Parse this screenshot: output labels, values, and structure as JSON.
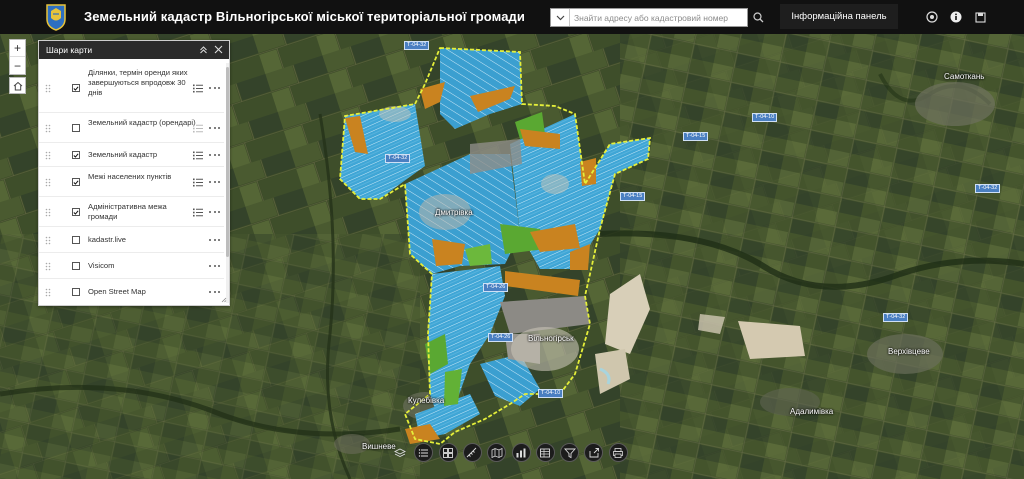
{
  "app": {
    "title": "Земельний кадастр Вільногірської міської територіальної громади",
    "search_placeholder": "Знайти адресу або кадастровий номер",
    "info_panel_label": "Інформаційна панель"
  },
  "layers_panel": {
    "title": "Шари карти",
    "layers": [
      {
        "label": "Ділянки, термін оренди яких завершуються впродовж 30 днів",
        "checked": true,
        "has_legend": true
      },
      {
        "label": "Земельний кадастр (орендарі)",
        "checked": false,
        "has_legend": true
      },
      {
        "label": "Земельний кадастр",
        "checked": true,
        "has_legend": true
      },
      {
        "label": "Межі населених пунктів",
        "checked": true,
        "has_legend": true
      },
      {
        "label": "Адміністративна межа громади",
        "checked": true,
        "has_legend": true
      },
      {
        "label": "kadastr.live",
        "checked": false,
        "has_legend": false
      },
      {
        "label": "Visicom",
        "checked": false,
        "has_legend": false
      },
      {
        "label": "Open Street Map",
        "checked": false,
        "has_legend": false
      }
    ]
  },
  "map": {
    "places": {
      "dmytrivka": "Дмитрівка",
      "vilnohirsk": "Вільногірськ",
      "kulebivka": "Кулебівка",
      "vyshneve": "Вишневе",
      "adalymivka": "Адалимівка",
      "verkhivtseve": "Верхівцеве",
      "samotkan": "Самоткань"
    },
    "roads": {
      "r1": "Т-04-32",
      "r2": "Т-04-32",
      "r3": "Т-04-15",
      "r4": "Т-04-10",
      "r5": "Т-04-15",
      "r6": "Т-04-32",
      "r7": "Т-04-26",
      "r8": "Т-04-32",
      "r9": "Т-04-10",
      "r10": "Т-04-26"
    }
  },
  "icons": {
    "zoom_in": "plus-icon",
    "zoom_out": "minus-icon",
    "home": "home-icon",
    "search": "search-icon",
    "share": "eye-icon",
    "info": "info-icon",
    "save": "save-icon",
    "tools": [
      "layers-icon",
      "list-icon",
      "grid-icon",
      "measure-icon",
      "basemap-icon",
      "chart-icon",
      "table-icon",
      "filter-icon",
      "export-icon",
      "print-icon"
    ]
  },
  "colors": {
    "header": "#111111",
    "parcel_blue": "#3fa6d6",
    "parcel_orange": "#c98320",
    "parcel_green": "#5aa832",
    "boundary": "#e5ef3a"
  }
}
